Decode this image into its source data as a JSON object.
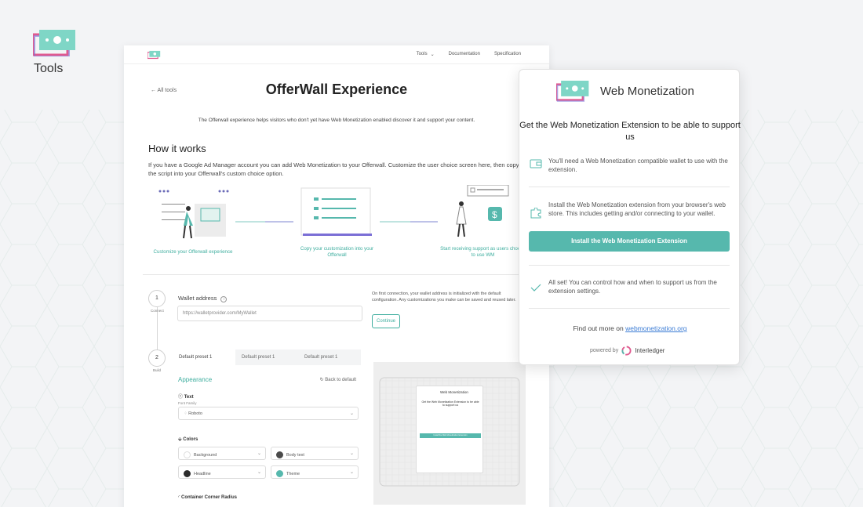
{
  "brand": {
    "label": "Tools"
  },
  "nav": {
    "items": [
      "Tools",
      "Documentation",
      "Specification"
    ]
  },
  "page": {
    "back_link": "← All tools",
    "title": "OfferWall Experience",
    "intro": "The Offerwall experience helps visitors who don't yet have Web Monetization enabled discover it and support your content.",
    "how_title": "How it works",
    "how_text": "If you have a Google Ad Manager account you can add Web Monetization to your Offerwall. Customize the user choice screen here, then copy the script into your Offerwall's custom choice option.",
    "steps": [
      "Customize your Offerwall experience",
      "Copy your customization into your Offerwall",
      "Start receiving support as users choose to use WM"
    ]
  },
  "connect": {
    "step_number": "1",
    "step_label": "Connect",
    "wallet_label": "Wallet address",
    "wallet_placeholder": "https://walletprovider.com/MyWallet",
    "note": "On first connection, your wallet address is initialized with the default configuration. Any customizations you make can be saved and reused later.",
    "continue_label": "Continue"
  },
  "build": {
    "step_number": "2",
    "step_label": "Build",
    "tabs": [
      "Default preset 1",
      "Default preset 1",
      "Default preset 1"
    ],
    "appearance": "Appearance",
    "back_default": "Back to default",
    "text_label": "Text",
    "font_family_label": "Font Family",
    "font_value": "Roboto",
    "colors_label": "Colors",
    "color_fields": [
      {
        "label": "Background",
        "color": "#ffffff"
      },
      {
        "label": "Body text",
        "color": "#4a4a4a"
      },
      {
        "label": "Headline",
        "color": "#2b2b2b"
      },
      {
        "label": "Theme",
        "color": "#56b8ad"
      }
    ],
    "corner_label": "Container Corner Radius"
  },
  "popup": {
    "title": "Web Monetization",
    "heading": "Get the Web Monetization Extension to be able to support us",
    "item1": "You'll need a Web Monetization compatible wallet to use with the extension.",
    "item2": "Install the Web Monetization extension from your browser's web store. This includes getting and/or connecting to your wallet.",
    "install_button": "Install the Web Monetization Extension",
    "item3": "All set! You can control how and when to support us from the extension settings.",
    "findout_prefix": "Find out more on",
    "findout_link": "webmonetization.org",
    "powered_by": "powered by",
    "interledger": "Interledger"
  },
  "colors": {
    "accent": "#56b8ad",
    "accent_dark": "#3fae9f",
    "link": "#3a7bd5"
  }
}
